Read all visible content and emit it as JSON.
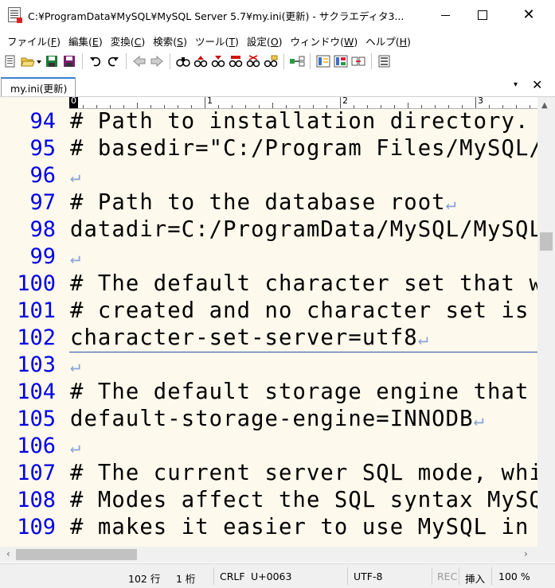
{
  "window": {
    "title": "C:¥ProgramData¥MySQL¥MySQL Server 5.7¥my.ini(更新) - サクラエディタ3...",
    "minimize_icon": "minimize-icon",
    "maximize_icon": "maximize-icon",
    "close_icon": "close-icon"
  },
  "menu": [
    {
      "label": "ファイル",
      "key": "F"
    },
    {
      "label": "編集",
      "key": "E"
    },
    {
      "label": "変換",
      "key": "C"
    },
    {
      "label": "検索",
      "key": "S"
    },
    {
      "label": "ツール",
      "key": "T"
    },
    {
      "label": "設定",
      "key": "O"
    },
    {
      "label": "ウィンドウ",
      "key": "W"
    },
    {
      "label": "ヘルプ",
      "key": "H"
    }
  ],
  "tab": {
    "label": "my.ini(更新)",
    "dropdown_glyph": "▾",
    "close_glyph": "✕"
  },
  "ruler": {
    "marks": [
      "0",
      "1",
      "2",
      "3"
    ]
  },
  "editor": {
    "lines": [
      {
        "num": "94",
        "text": "# Path to installation directory. A",
        "eol": ""
      },
      {
        "num": "95",
        "text": "# basedir=\"C:/Program Files/MySQL/M",
        "eol": ""
      },
      {
        "num": "96",
        "text": "",
        "eol": "↵"
      },
      {
        "num": "97",
        "text": "# Path to the database root",
        "eol": "↵"
      },
      {
        "num": "98",
        "text": "datadir=C:/ProgramData/MySQL/MySQL ",
        "eol": ""
      },
      {
        "num": "99",
        "text": "",
        "eol": "↵"
      },
      {
        "num": "100",
        "text": "# The default character set that wi",
        "eol": ""
      },
      {
        "num": "101",
        "text": "# created and no character set is d",
        "eol": ""
      },
      {
        "num": "102",
        "text": "character-set-server=utf8",
        "eol": "↵"
      },
      {
        "num": "103",
        "text": "",
        "eol": "↵"
      },
      {
        "num": "104",
        "text": "# The default storage engine that w",
        "eol": ""
      },
      {
        "num": "105",
        "text": "default-storage-engine=INNODB",
        "eol": "↵"
      },
      {
        "num": "106",
        "text": "",
        "eol": "↵"
      },
      {
        "num": "107",
        "text": "# The current server SQL mode, whic",
        "eol": ""
      },
      {
        "num": "108",
        "text": "# Modes affect the SQL syntax MySQL",
        "eol": ""
      },
      {
        "num": "109",
        "text": "# makes it easier to use MySQL in d",
        "eol": ""
      }
    ]
  },
  "status": {
    "line": "102 行",
    "col": "1 桁",
    "eol_type": "CRLF",
    "codepoint": "U+0063",
    "encoding": "UTF-8",
    "rec": "REC",
    "mode": "挿入",
    "zoom": "100 %"
  },
  "colors": {
    "editor_bg": "#fdf9ec",
    "line_number": "#0000e6",
    "eol_mark": "#8aa4d6",
    "cursor_line": "#2b4fa0"
  }
}
